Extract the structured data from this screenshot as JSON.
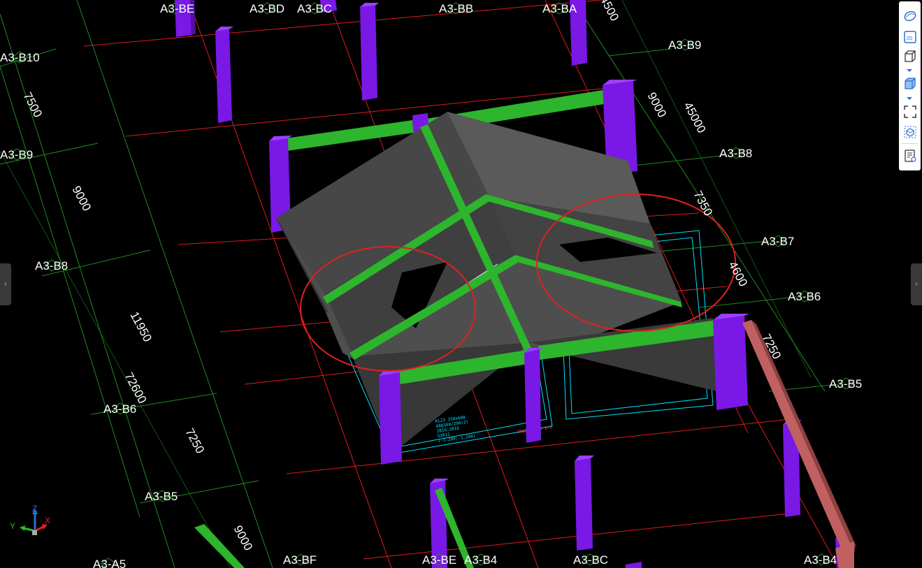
{
  "grid_labels": [
    "A3-BE",
    "A3-BD",
    "A3-BC",
    "A3-BB",
    "A3-BA",
    "A3-B10",
    "A3-B9",
    "A3-B9",
    "A3-B8",
    "A3-B8",
    "A3-B7",
    "A3-B6",
    "A3-B6",
    "A3-B5",
    "A3-B5",
    "A3-A5",
    "A3-BF",
    "A3-BE",
    "A3-B4",
    "A3-BC",
    "A3-B4"
  ],
  "dimensions": [
    "7500",
    "9000",
    "11950",
    "72600",
    "7250",
    "9000",
    "4500",
    "9000",
    "45000",
    "7350",
    "4600",
    "7250"
  ],
  "annotations": {
    "left_block": [
      "KL23  250x600",
      "A8@100/200(2)",
      "2B16;2B16",
      "G2B12",
      "(-1.200;-1.200)"
    ],
    "right_block": "20@100/200 2/2"
  },
  "toolbar": {
    "items": [
      {
        "name": "perspective-view",
        "icon": "perspective-icon"
      },
      {
        "name": "2d-view",
        "icon": "2d-icon",
        "label": "2D"
      },
      {
        "name": "3d-wireframe-view",
        "icon": "cube-outline-icon"
      },
      {
        "name": "3d-solid-view",
        "icon": "cube-solid-icon"
      },
      {
        "name": "fit-view",
        "icon": "fullscreen-icon"
      },
      {
        "name": "section-box",
        "icon": "section-box-icon"
      },
      {
        "name": "properties-panel",
        "icon": "properties-icon"
      }
    ]
  },
  "side_tabs": {
    "left": "‹",
    "right": "›"
  },
  "axis_triad": {
    "x": "X",
    "y": "Y",
    "z": "Z"
  },
  "colors": {
    "grid": "#1f8c1f",
    "axis_line": "#e01c1c",
    "column": "#7a18e6",
    "beam": "#2db52d",
    "slab": "#4e4e4e",
    "highlight_circle": "#e02020",
    "ramp": "#c06060",
    "annotation": "#00e5ff"
  }
}
